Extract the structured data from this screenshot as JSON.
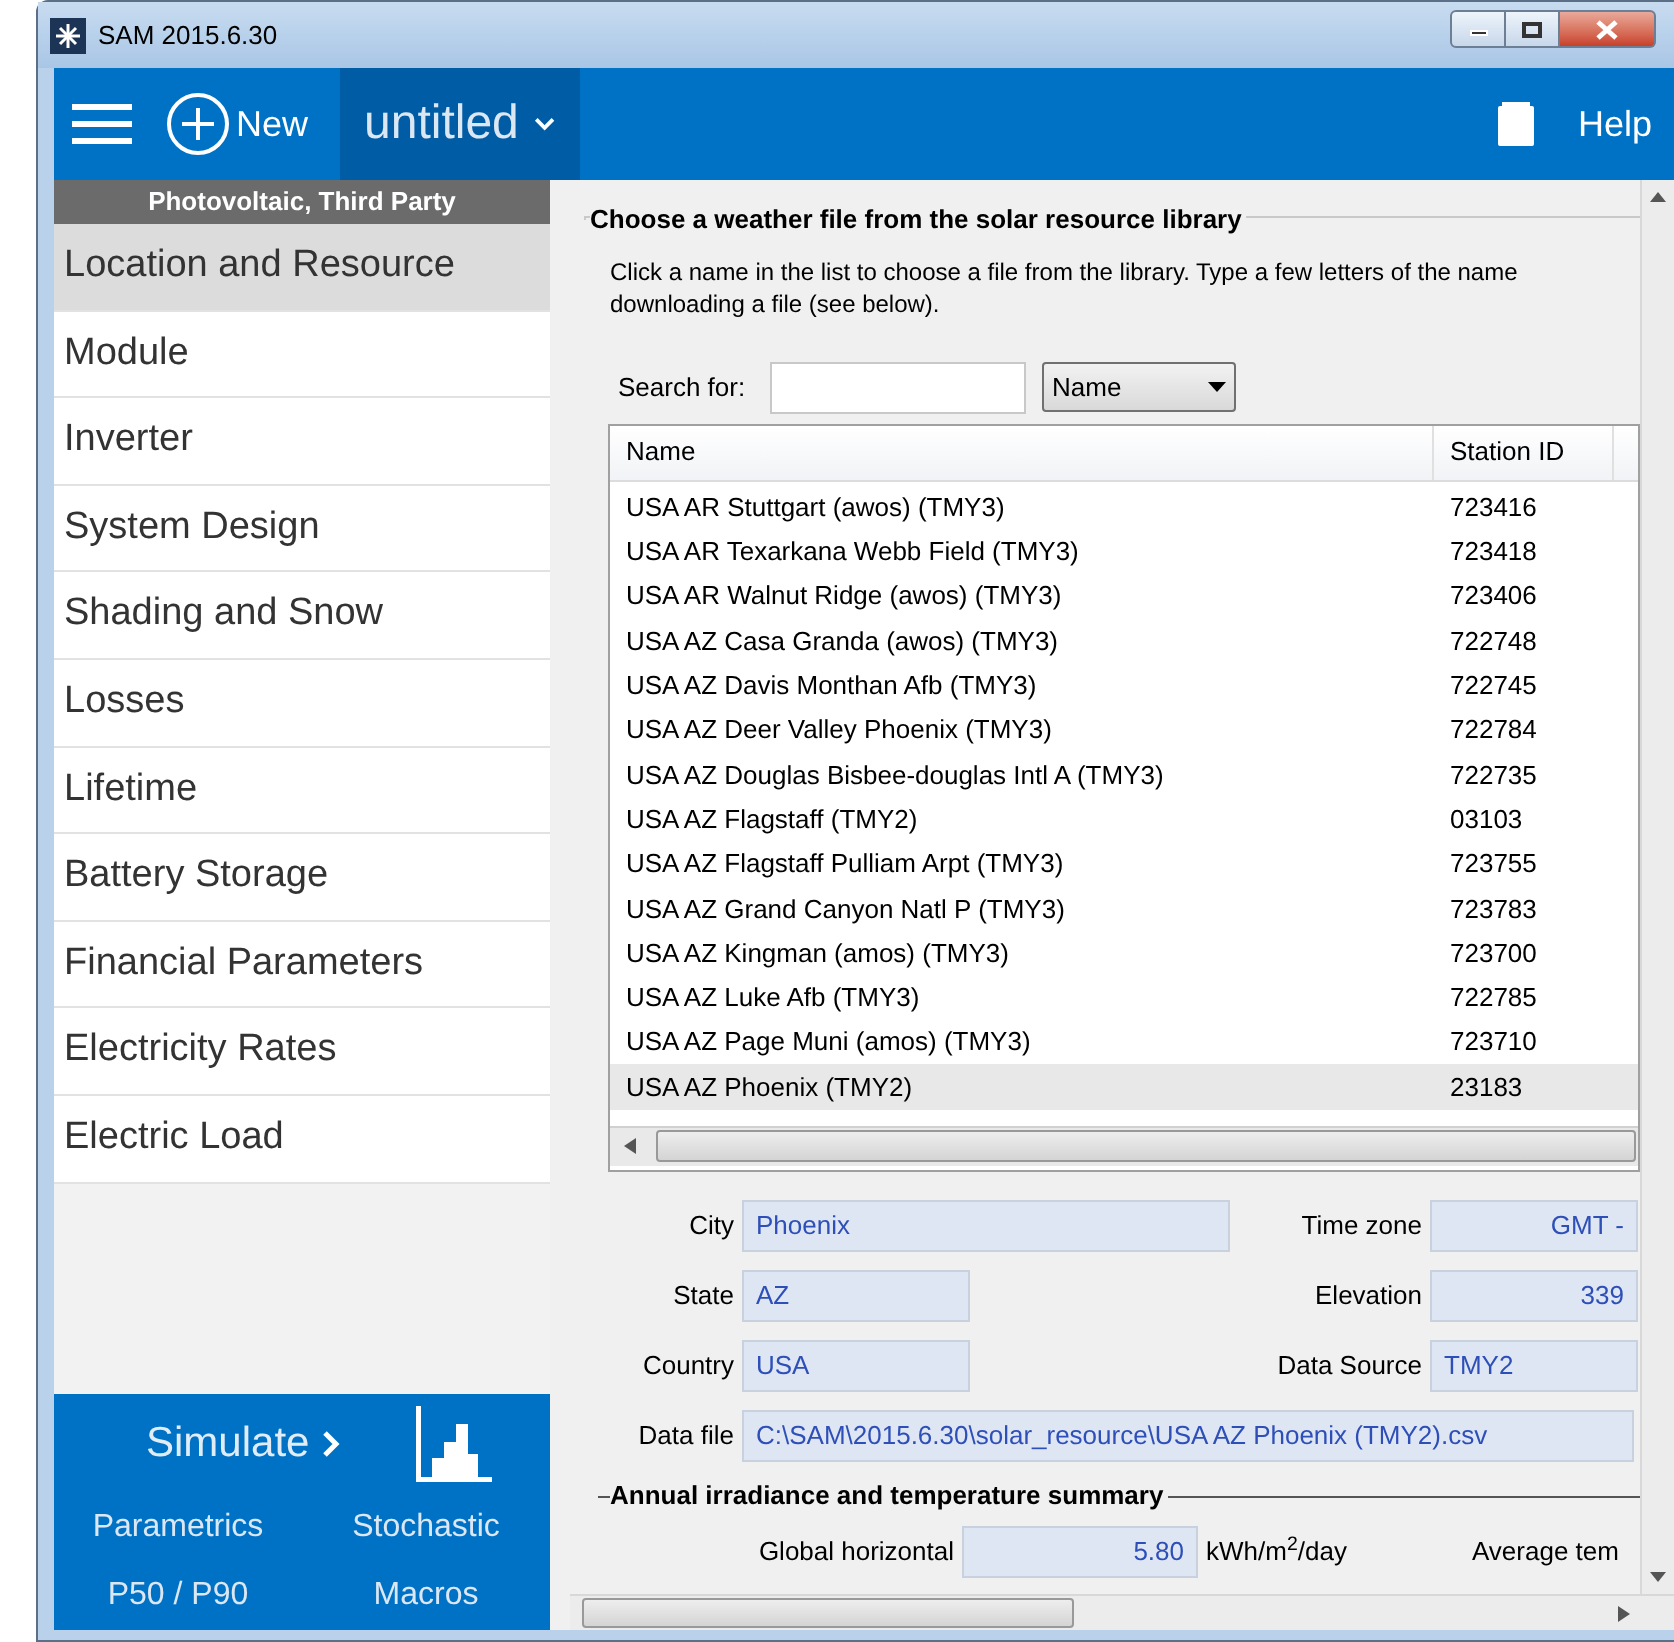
{
  "window": {
    "title": "SAM 2015.6.30"
  },
  "toolbar": {
    "new_label": "New",
    "file_name": "untitled",
    "help_label": "Help"
  },
  "sidebar": {
    "header": "Photovoltaic, Third Party",
    "items": [
      {
        "label": "Location and Resource",
        "selected": true
      },
      {
        "label": "Module",
        "selected": false
      },
      {
        "label": "Inverter",
        "selected": false
      },
      {
        "label": "System Design",
        "selected": false
      },
      {
        "label": "Shading and Snow",
        "selected": false
      },
      {
        "label": "Losses",
        "selected": false
      },
      {
        "label": "Lifetime",
        "selected": false
      },
      {
        "label": "Battery Storage",
        "selected": false
      },
      {
        "label": "Financial Parameters",
        "selected": false
      },
      {
        "label": "Electricity Rates",
        "selected": false
      },
      {
        "label": "Electric Load",
        "selected": false
      }
    ],
    "simulate_label": "Simulate",
    "links": [
      "Parametrics",
      "Stochastic",
      "P50 / P90",
      "Macros"
    ]
  },
  "weather": {
    "title": "Choose a weather file from the solar resource library",
    "description": [
      "Click a name in the list to choose a file from the library. Type a few letters of the name",
      "downloading a file (see below)."
    ],
    "search_label": "Search for:",
    "search_by": "Name",
    "columns": [
      "Name",
      "Station ID"
    ],
    "rows": [
      {
        "name": "USA AR Stuttgart (awos) (TMY3)",
        "station_id": "723416",
        "selected": false
      },
      {
        "name": "USA AR Texarkana Webb Field (TMY3)",
        "station_id": "723418",
        "selected": false
      },
      {
        "name": "USA AR Walnut Ridge (awos) (TMY3)",
        "station_id": "723406",
        "selected": false
      },
      {
        "name": "USA AZ Casa Granda (awos) (TMY3)",
        "station_id": "722748",
        "selected": false
      },
      {
        "name": "USA AZ Davis Monthan Afb (TMY3)",
        "station_id": "722745",
        "selected": false
      },
      {
        "name": "USA AZ Deer Valley Phoenix (TMY3)",
        "station_id": "722784",
        "selected": false
      },
      {
        "name": "USA AZ Douglas Bisbee-douglas Intl A (TMY3)",
        "station_id": "722735",
        "selected": false
      },
      {
        "name": "USA AZ Flagstaff (TMY2)",
        "station_id": "03103",
        "selected": false
      },
      {
        "name": "USA AZ Flagstaff Pulliam Arpt (TMY3)",
        "station_id": "723755",
        "selected": false
      },
      {
        "name": "USA AZ Grand Canyon Natl P (TMY3)",
        "station_id": "723783",
        "selected": false
      },
      {
        "name": "USA AZ Kingman (amos) (TMY3)",
        "station_id": "723700",
        "selected": false
      },
      {
        "name": "USA AZ Luke Afb (TMY3)",
        "station_id": "722785",
        "selected": false
      },
      {
        "name": "USA AZ Page Muni (amos) (TMY3)",
        "station_id": "723710",
        "selected": false
      },
      {
        "name": "USA AZ Phoenix (TMY2)",
        "station_id": "23183",
        "selected": true
      }
    ]
  },
  "location": {
    "city": {
      "label": "City",
      "value": "Phoenix"
    },
    "time_zone": {
      "label": "Time zone",
      "value": "GMT -"
    },
    "state": {
      "label": "State",
      "value": "AZ"
    },
    "elevation": {
      "label": "Elevation",
      "value": "339"
    },
    "country": {
      "label": "Country",
      "value": "USA"
    },
    "data_source": {
      "label": "Data Source",
      "value": "TMY2"
    },
    "data_file": {
      "label": "Data file",
      "value": "C:\\SAM\\2015.6.30\\solar_resource\\USA AZ Phoenix (TMY2).csv"
    }
  },
  "summary": {
    "title": "Annual irradiance and temperature summary",
    "global_horizontal": {
      "label": "Global horizontal",
      "value": "5.80",
      "unit": "kWh/m$^{2}$/day"
    },
    "next_label": "Average tem"
  }
}
